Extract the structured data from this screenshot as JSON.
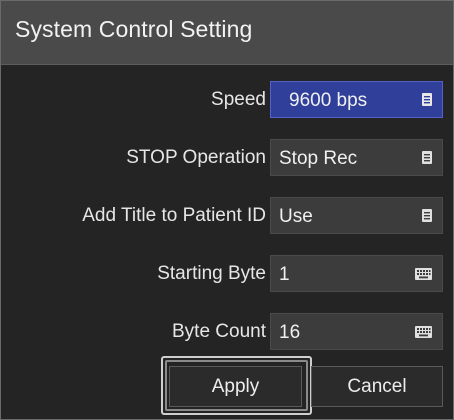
{
  "dialog": {
    "title": "System Control Setting"
  },
  "settings": [
    {
      "label": "Speed",
      "value": "9600 bps",
      "control": "list",
      "icon": "list-icon",
      "selected": true
    },
    {
      "label": "STOP Operation",
      "value": "Stop Rec",
      "control": "list",
      "icon": "list-icon",
      "selected": false
    },
    {
      "label": "Add Title to Patient ID",
      "value": "Use",
      "control": "list",
      "icon": "list-icon",
      "selected": false
    },
    {
      "label": "Starting Byte",
      "value": "1",
      "control": "keyboard",
      "icon": "keyboard-icon",
      "selected": false
    },
    {
      "label": "Byte Count",
      "value": "16",
      "control": "keyboard",
      "icon": "keyboard-icon",
      "selected": false
    }
  ],
  "buttons": {
    "apply_label": "Apply",
    "cancel_label": "Cancel",
    "focused": "apply"
  },
  "colors": {
    "titlebar": "#4a4a4a",
    "background": "#242424",
    "field": "#3c3c3c",
    "selected_field": "#2f3f9a",
    "text": "#f0f0f0"
  }
}
